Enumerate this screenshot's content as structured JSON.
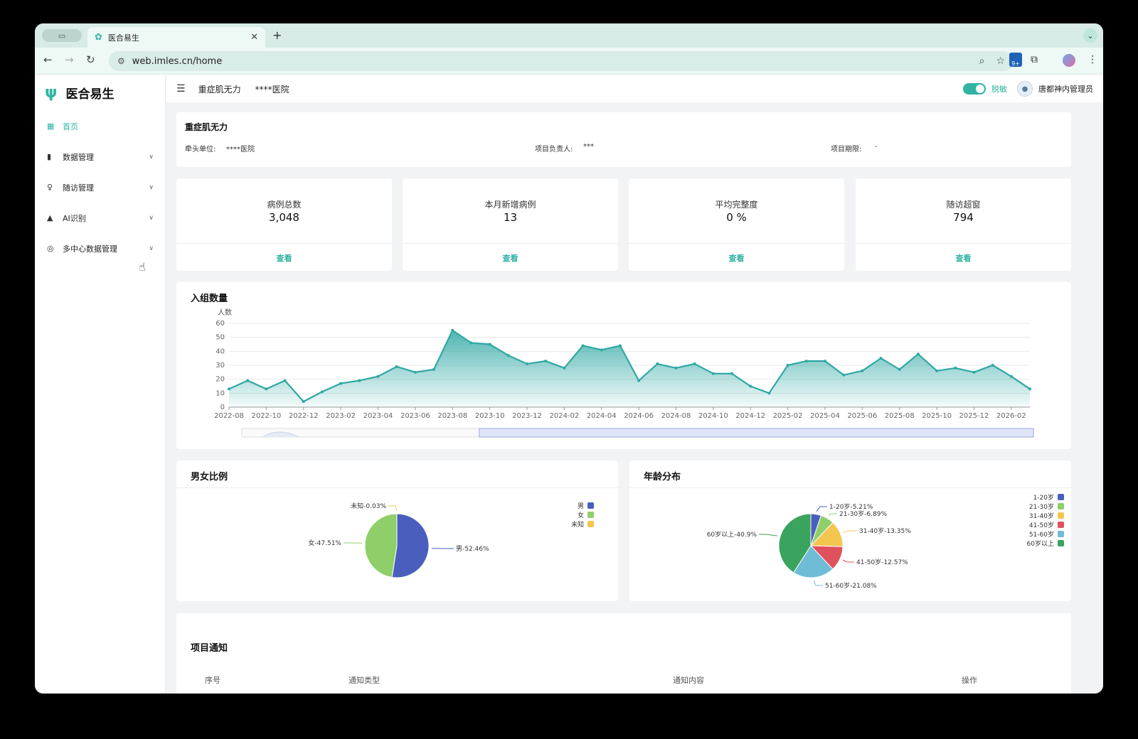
{
  "browser": {
    "tab_title": "医合易生",
    "url": "web.imles.cn/home",
    "ext_badge": "9+"
  },
  "app": {
    "logo_text": "医合易生",
    "menu": [
      {
        "label": "首页",
        "icon": "dashboard-icon",
        "active": true
      },
      {
        "label": "数据管理",
        "icon": "bar-chart-icon"
      },
      {
        "label": "随访管理",
        "icon": "follow-up-icon"
      },
      {
        "label": "AI识别",
        "icon": "bell-icon"
      },
      {
        "label": "多中心数据管理",
        "icon": "multi-center-icon"
      }
    ]
  },
  "header": {
    "project": "重症肌无力",
    "hospital": "****医院",
    "toggle_label": "脱敏",
    "user": "唐都神内管理员"
  },
  "project_info": {
    "title": "重症肌无力",
    "lead_label": "牵头单位:",
    "lead_value": "****医院",
    "owner_label": "项目负责人:",
    "owner_value": "***",
    "period_label": "项目期限:",
    "period_value": "-"
  },
  "stats": [
    {
      "label": "病例总数",
      "value": "3,048",
      "link": "查看"
    },
    {
      "label": "本月新增病例",
      "value": "13",
      "link": "查看"
    },
    {
      "label": "平均完整度",
      "value": "0 %",
      "link": "查看"
    },
    {
      "label": "随访超窗",
      "value": "794",
      "link": "查看"
    }
  ],
  "enroll": {
    "title": "入组数量"
  },
  "gender": {
    "title": "男女比例"
  },
  "age": {
    "title": "年龄分布"
  },
  "notice": {
    "title": "项目通知",
    "columns": [
      "序号",
      "通知类型",
      "通知内容",
      "操作"
    ]
  },
  "chart_data": [
    {
      "type": "area",
      "title": "入组数量",
      "ylabel": "人数",
      "ylim": [
        0,
        60
      ],
      "yticks": [
        0,
        10,
        20,
        30,
        40,
        50,
        60
      ],
      "x": [
        "2022-08",
        "2022-09",
        "2022-10",
        "2022-11",
        "2022-12",
        "2023-01",
        "2023-02",
        "2023-03",
        "2023-04",
        "2023-05",
        "2023-06",
        "2023-07",
        "2023-08",
        "2023-09",
        "2023-10",
        "2023-11",
        "2023-12",
        "2024-01",
        "2024-02",
        "2024-03",
        "2024-04",
        "2024-05",
        "2024-06",
        "2024-07",
        "2024-08",
        "2024-09",
        "2024-10",
        "2024-11",
        "2024-12",
        "2025-01",
        "2025-02",
        "2025-03",
        "2025-04",
        "2025-05",
        "2025-06",
        "2025-07",
        "2025-08",
        "2025-09",
        "2025-10",
        "2025-11",
        "2025-12",
        "2026-01",
        "2026-02",
        "2026-03"
      ],
      "xtick_labels": [
        "2022-08",
        "2022-10",
        "2022-12",
        "2023-02",
        "2023-04",
        "2023-06",
        "2023-08",
        "2023-10",
        "2023-12",
        "2024-02",
        "2024-04",
        "2024-06",
        "2024-08",
        "2024-10",
        "2024-12",
        "2025-02",
        "2025-04",
        "2025-06",
        "2025-08",
        "2025-10",
        "2025-12",
        "2026-02"
      ],
      "values": [
        13,
        19,
        13,
        19,
        4,
        11,
        17,
        19,
        22,
        29,
        25,
        27,
        55,
        46,
        45,
        37,
        31,
        33,
        28,
        44,
        41,
        44,
        19,
        31,
        28,
        31,
        24,
        24,
        15,
        10,
        30,
        33,
        33,
        23,
        26,
        35,
        27,
        38,
        26,
        28,
        25,
        30,
        22,
        13
      ],
      "color": "#2fa8a4",
      "zoom_range": [
        30,
        100
      ]
    },
    {
      "type": "pie",
      "title": "男女比例",
      "labels": [
        "男",
        "女",
        "未知"
      ],
      "values": [
        52.46,
        47.51,
        0.03
      ],
      "data_labels": [
        "男-52.46%",
        "女-47.51%",
        "未知-0.03%"
      ],
      "colors": [
        "#4a5fbd",
        "#8ecf6a",
        "#f3c650"
      ],
      "legend": "top-right"
    },
    {
      "type": "pie",
      "title": "年龄分布",
      "labels": [
        "1-20岁",
        "21-30岁",
        "31-40岁",
        "41-50岁",
        "51-60岁",
        "60岁以上"
      ],
      "values": [
        5.21,
        6.89,
        13.35,
        12.57,
        21.08,
        40.9
      ],
      "data_labels": [
        "1-20岁-5.21%",
        "21-30岁-6.89%",
        "31-40岁-13.35%",
        "41-50岁-12.57%",
        "51-60岁-21.08%",
        "60岁以上-40.9%"
      ],
      "colors": [
        "#4a5fbd",
        "#8ecf6a",
        "#f3c650",
        "#e0515e",
        "#6fbcd6",
        "#3aa35d"
      ],
      "legend": "top-right"
    }
  ]
}
